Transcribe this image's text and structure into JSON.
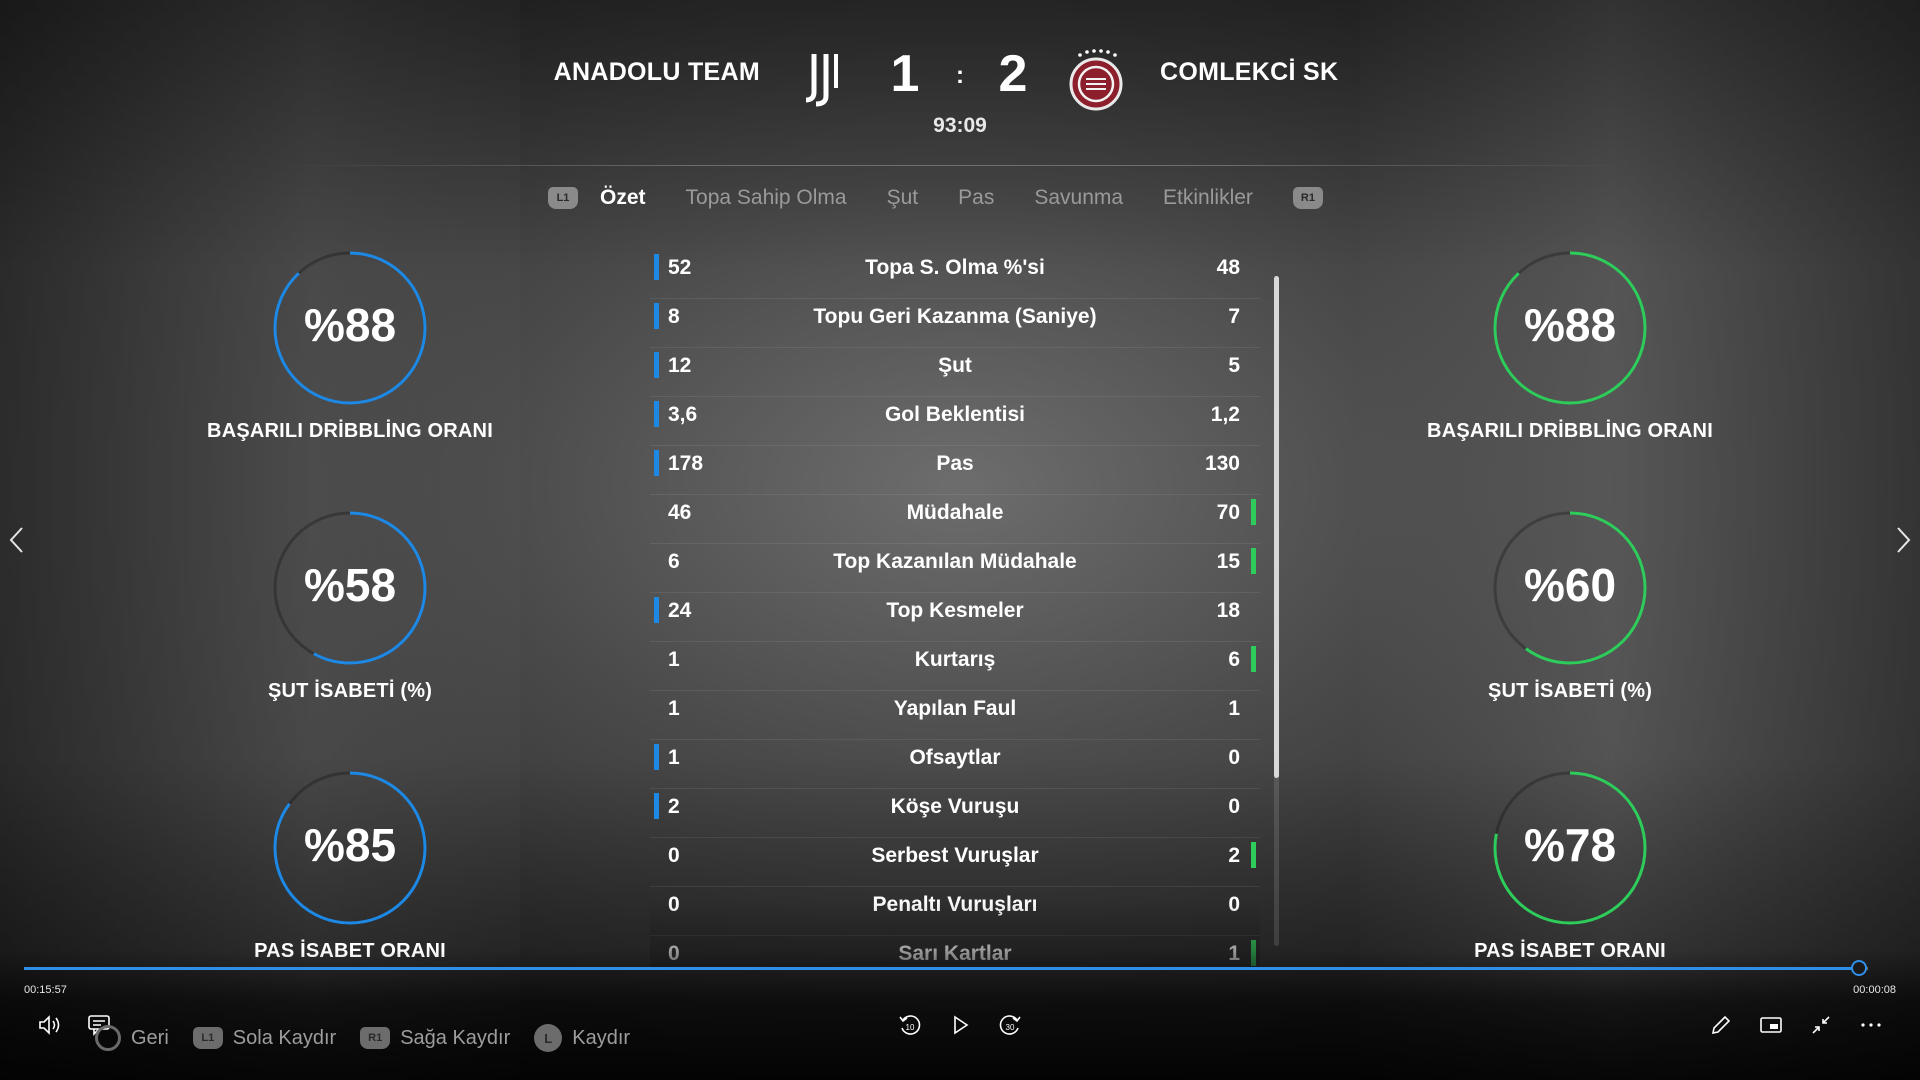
{
  "match": {
    "home_team": "ANADOLU TEAM",
    "away_team": "COMLEKCİ SK",
    "home_score": "1",
    "separator": ":",
    "away_score": "2",
    "clock": "93:09"
  },
  "tabs": {
    "left_button": "L1",
    "right_button": "R1",
    "items": [
      {
        "label": "Özet",
        "active": true
      },
      {
        "label": "Topa Sahip Olma",
        "active": false
      },
      {
        "label": "Şut",
        "active": false
      },
      {
        "label": "Pas",
        "active": false
      },
      {
        "label": "Savunma",
        "active": false
      },
      {
        "label": "Etkinlikler",
        "active": false
      }
    ]
  },
  "gauges": {
    "home": [
      {
        "value": "%88",
        "percent": 88,
        "label": "BAŞARILI DRİBBLİNG ORANI"
      },
      {
        "value": "%58",
        "percent": 58,
        "label": "ŞUT İSABETİ (%)"
      },
      {
        "value": "%85",
        "percent": 85,
        "label": "PAS İSABET ORANI"
      }
    ],
    "away": [
      {
        "value": "%88",
        "percent": 88,
        "label": "BAŞARILI DRİBBLİNG ORANI"
      },
      {
        "value": "%60",
        "percent": 60,
        "label": "ŞUT İSABETİ (%)"
      },
      {
        "value": "%78",
        "percent": 78,
        "label": "PAS İSABET ORANI"
      }
    ],
    "home_color": "#1e88e5",
    "away_color": "#2ecc5a"
  },
  "stats": [
    {
      "home": "52",
      "label": "Topa S. Olma %'si",
      "away": "48",
      "leader": "home"
    },
    {
      "home": "8",
      "label": "Topu Geri Kazanma (Saniye)",
      "away": "7",
      "leader": "home"
    },
    {
      "home": "12",
      "label": "Şut",
      "away": "5",
      "leader": "home"
    },
    {
      "home": "3,6",
      "label": "Gol Beklentisi",
      "away": "1,2",
      "leader": "home"
    },
    {
      "home": "178",
      "label": "Pas",
      "away": "130",
      "leader": "home"
    },
    {
      "home": "46",
      "label": "Müdahale",
      "away": "70",
      "leader": "away"
    },
    {
      "home": "6",
      "label": "Top Kazanılan Müdahale",
      "away": "15",
      "leader": "away"
    },
    {
      "home": "24",
      "label": "Top Kesmeler",
      "away": "18",
      "leader": "home"
    },
    {
      "home": "1",
      "label": "Kurtarış",
      "away": "6",
      "leader": "away"
    },
    {
      "home": "1",
      "label": "Yapılan Faul",
      "away": "1",
      "leader": "none"
    },
    {
      "home": "1",
      "label": "Ofsaytlar",
      "away": "0",
      "leader": "home"
    },
    {
      "home": "2",
      "label": "Köşe Vuruşu",
      "away": "0",
      "leader": "home"
    },
    {
      "home": "0",
      "label": "Serbest Vuruşlar",
      "away": "2",
      "leader": "away"
    },
    {
      "home": "0",
      "label": "Penaltı Vuruşları",
      "away": "0",
      "leader": "none"
    },
    {
      "home": "0",
      "label": "Sarı Kartlar",
      "away": "1",
      "leader": "away"
    }
  ],
  "player": {
    "elapsed": "00:15:57",
    "remaining": "00:00:08",
    "progress": 0.995,
    "hints": [
      {
        "button": "circle",
        "label": "Geri"
      },
      {
        "button": "L1",
        "label": "Sola Kaydır"
      },
      {
        "button": "R1",
        "label": "Sağa Kaydır"
      },
      {
        "button": "L",
        "label": "Kaydır"
      }
    ],
    "icons": [
      "volume-icon",
      "captions-icon",
      "rewind-10-icon",
      "play-icon",
      "forward-30-icon",
      "edit-icon",
      "miniplayer-icon",
      "exit-fullscreen-icon",
      "more-icon"
    ]
  }
}
